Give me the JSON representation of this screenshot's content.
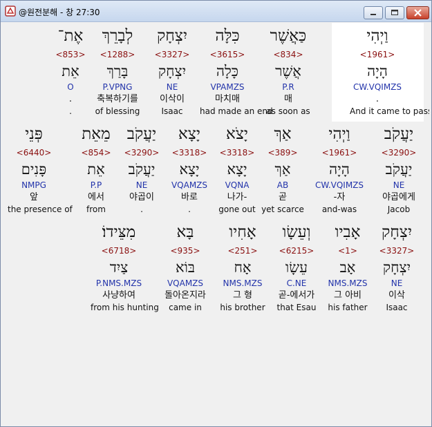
{
  "window": {
    "title": "@원전분해 - 창 27:30",
    "colors": {
      "hebrew": "#111111",
      "strong": "#8a1010",
      "parse": "#2233aa",
      "highlight": "#ffffff"
    }
  },
  "rows": [
    {
      "words": [
        {
          "heb": "אֶת־",
          "strong": "<853>",
          "lemma": "אֵת",
          "parse": "O",
          "kor": ".",
          "eng": "."
        },
        {
          "heb": "לְבָרֵךְ",
          "strong": "<1288>",
          "lemma": "בָּרַךְ",
          "parse": "P.VPNG",
          "kor": "축복하기를",
          "eng": "of blessing"
        },
        {
          "heb": "יִצְחָק",
          "strong": "<3327>",
          "lemma": "יִצְחָק",
          "parse": "NE",
          "kor": "이삭이",
          "eng": "Isaac"
        },
        {
          "heb": "כִּלָּה",
          "strong": "<3615>",
          "lemma": "כָּלָה",
          "parse": "VPAMZS",
          "kor": "마치매",
          "eng": "had made an end"
        },
        {
          "heb": "כַּאֲשֶׁר",
          "strong": "<834>",
          "lemma": "אֲשֶׁר",
          "parse": "P.R",
          "kor": "매",
          "eng": "as soon as"
        },
        {
          "heb": "וַיְהִי",
          "strong": "<1961>",
          "lemma": "הָיָה",
          "parse": "CW.VQIMZS",
          "kor": ".",
          "eng": "And it came to pass"
        }
      ]
    },
    {
      "words": [
        {
          "heb": "פְּנֵי",
          "strong": "<6440>",
          "lemma": "פָּנִים",
          "parse": "NMPG",
          "kor": "앞",
          "eng": "the presence of"
        },
        {
          "heb": "מֵאֵת",
          "strong": "<854>",
          "lemma": "אֵת",
          "parse": "P.P",
          "kor": "에서",
          "eng": "from"
        },
        {
          "heb": "יַעֲקֹב",
          "strong": "<3290>",
          "lemma": "יַעֲקֹב",
          "parse": "NE",
          "kor": "야곱이",
          "eng": "."
        },
        {
          "heb": "יָצָא",
          "strong": "<3318>",
          "lemma": "יָצָא",
          "parse": "VQAMZS",
          "kor": "바로",
          "eng": "."
        },
        {
          "heb": "יָצֹא",
          "strong": "<3318>",
          "lemma": "יָצָא",
          "parse": "VQNA",
          "kor": "나가-",
          "eng": "gone out"
        },
        {
          "heb": "אַךְ",
          "strong": "<389>",
          "lemma": "אַךְ",
          "parse": "AB",
          "kor": "곧",
          "eng": "yet scarce"
        },
        {
          "heb": "וַיְהִי",
          "strong": "<1961>",
          "lemma": "הָיָה",
          "parse": "CW.VQIMZS",
          "kor": "-자",
          "eng": "and-was"
        },
        {
          "heb": "יַעֲקֹב",
          "strong": "<3290>",
          "lemma": "יַעֲקֹב",
          "parse": "NE",
          "kor": "야곱에게",
          "eng": "Jacob"
        }
      ]
    },
    {
      "words": [
        {
          "heb": "מִצֵּידוֹ׃",
          "strong": "<6718>",
          "lemma": "צַיִד",
          "parse": "P.NMS.MZS",
          "kor": "사냥하여",
          "eng": "from his hunting"
        },
        {
          "heb": "בָּא",
          "strong": "<935>",
          "lemma": "בּוֹא",
          "parse": "VQAMZS",
          "kor": "돌아온지라",
          "eng": "came in"
        },
        {
          "heb": "אָחִיו",
          "strong": "<251>",
          "lemma": "אָח",
          "parse": "NMS.MZS",
          "kor": "그 형",
          "eng": "his brother"
        },
        {
          "heb": "וְעֵשָׂו",
          "strong": "<6215>",
          "lemma": "עֵשָׂו",
          "parse": "C.NE",
          "kor": "곧-에서가",
          "eng": "that Esau"
        },
        {
          "heb": "אָבִיו",
          "strong": "<1>",
          "lemma": "אָב",
          "parse": "NMS.MZS",
          "kor": "그 아비",
          "eng": "his father"
        },
        {
          "heb": "יִצְחָק",
          "strong": "<3327>",
          "lemma": "יִצְחָק",
          "parse": "NE",
          "kor": "이삭",
          "eng": "Isaac"
        }
      ]
    }
  ]
}
